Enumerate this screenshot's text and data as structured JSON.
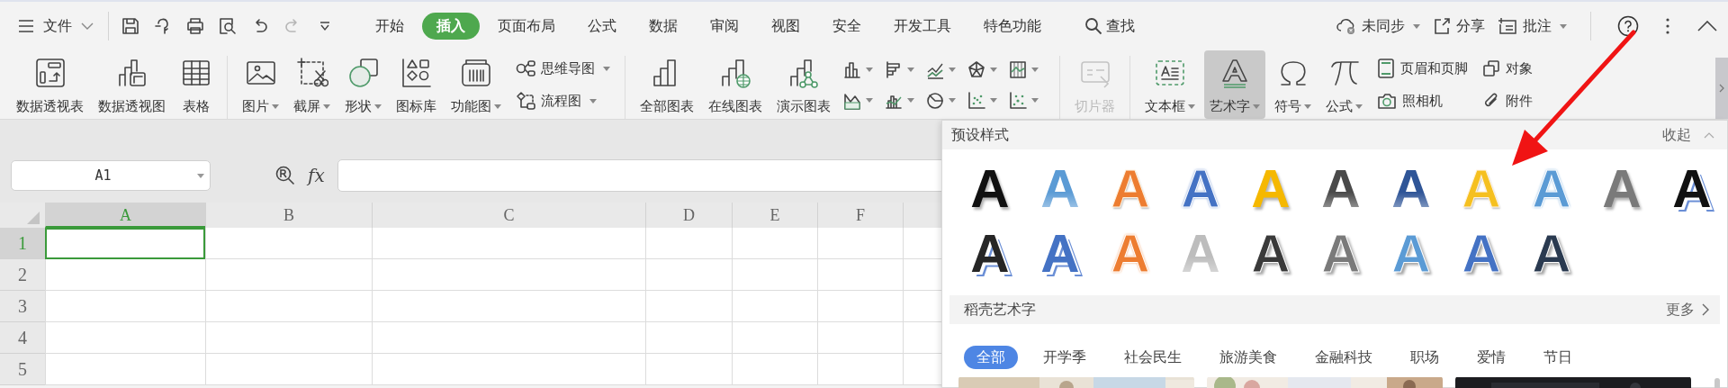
{
  "menu": {
    "label": "文件"
  },
  "quick_access": [
    {
      "disabled": false
    },
    {
      "disabled": false
    },
    {
      "disabled": false
    },
    {
      "disabled": false
    },
    {
      "disabled": false
    },
    {
      "disabled": true
    }
  ],
  "tabs": [
    {
      "label": "开始",
      "selected": false
    },
    {
      "label": "插入",
      "selected": true
    },
    {
      "label": "页面布局",
      "selected": false
    },
    {
      "label": "公式",
      "selected": false
    },
    {
      "label": "数据",
      "selected": false
    },
    {
      "label": "审阅",
      "selected": false
    },
    {
      "label": "视图",
      "selected": false
    },
    {
      "label": "安全",
      "selected": false
    },
    {
      "label": "开发工具",
      "selected": false
    },
    {
      "label": "特色功能",
      "selected": false
    }
  ],
  "search": {
    "label": "查找"
  },
  "actions": [
    {
      "label": "未同步",
      "has_menu": true
    },
    {
      "label": "分享",
      "has_menu": false
    },
    {
      "label": "批注",
      "has_menu": true
    }
  ],
  "ribbon": {
    "groups": [
      {
        "items": [
          {
            "kind": "large",
            "label": "数据透视表",
            "has_menu": false,
            "pressed": false,
            "disabled": false
          },
          {
            "kind": "large",
            "label": "数据透视图",
            "has_menu": false,
            "pressed": false,
            "disabled": false
          },
          {
            "kind": "large",
            "label": "表格",
            "has_menu": false,
            "pressed": false,
            "disabled": false
          }
        ]
      },
      {
        "items": [
          {
            "kind": "large",
            "label": "图片",
            "has_menu": true,
            "pressed": false,
            "disabled": false
          },
          {
            "kind": "large",
            "label": "截屏",
            "has_menu": true,
            "pressed": false,
            "disabled": false
          },
          {
            "kind": "large",
            "label": "形状",
            "has_menu": true,
            "pressed": false,
            "disabled": false
          },
          {
            "kind": "large",
            "label": "图标库",
            "has_menu": false,
            "pressed": false,
            "disabled": false
          },
          {
            "kind": "large",
            "label": "功能图",
            "has_menu": true,
            "pressed": false,
            "disabled": false
          },
          {
            "kind": "stack",
            "items": [
              {
                "label": "思维导图",
                "has_menu": true
              },
              {
                "label": "流程图",
                "has_menu": true
              }
            ]
          }
        ]
      },
      {
        "items": [
          {
            "kind": "large",
            "label": "全部图表",
            "has_menu": false,
            "pressed": false,
            "disabled": false
          },
          {
            "kind": "large",
            "label": "在线图表",
            "has_menu": false,
            "pressed": false,
            "disabled": false
          },
          {
            "kind": "large",
            "label": "演示图表",
            "has_menu": false,
            "pressed": false,
            "disabled": false
          },
          {
            "kind": "charts"
          }
        ]
      },
      {
        "items": [
          {
            "kind": "large",
            "label": "切片器",
            "has_menu": false,
            "pressed": false,
            "disabled": true
          }
        ]
      },
      {
        "items": [
          {
            "kind": "large",
            "label": "文本框",
            "has_menu": true,
            "pressed": false,
            "disabled": false
          },
          {
            "kind": "large",
            "label": "艺术字",
            "has_menu": true,
            "pressed": true,
            "disabled": false
          },
          {
            "kind": "large",
            "label": "符号",
            "has_menu": true,
            "pressed": false,
            "disabled": false
          },
          {
            "kind": "large",
            "label": "公式",
            "has_menu": true,
            "pressed": false,
            "disabled": false
          },
          {
            "kind": "stack",
            "items": [
              {
                "label": "页眉和页脚",
                "has_menu": false
              },
              {
                "label": "照相机",
                "has_menu": false
              }
            ]
          },
          {
            "kind": "stack",
            "items": [
              {
                "label": "对象",
                "has_menu": false
              },
              {
                "label": "附件",
                "has_menu": false
              }
            ]
          }
        ]
      }
    ]
  },
  "sheet": {
    "name_box": {
      "value": "A1"
    },
    "formula_label": "fx",
    "columns": [
      {
        "label": "A",
        "selected": true
      },
      {
        "label": "B",
        "selected": false
      },
      {
        "label": "C",
        "selected": false
      },
      {
        "label": "D",
        "selected": false
      },
      {
        "label": "E",
        "selected": false
      },
      {
        "label": "F",
        "selected": false
      }
    ],
    "rows": [
      {
        "label": "1",
        "selected": true
      },
      {
        "label": "2",
        "selected": false
      },
      {
        "label": "3",
        "selected": false
      },
      {
        "label": "4",
        "selected": false
      },
      {
        "label": "5",
        "selected": false
      }
    ]
  },
  "wordart_panel": {
    "title": "预设样式",
    "collapse": "收起",
    "presets": [
      {
        "text": "A",
        "kind": "solid",
        "color": "#111111"
      },
      {
        "text": "A",
        "kind": "gradient",
        "color": "#5b9bd5"
      },
      {
        "text": "A",
        "kind": "filled-outline",
        "color": "#ed7d31"
      },
      {
        "text": "A",
        "kind": "outline",
        "color": "#4472c4"
      },
      {
        "text": "A",
        "kind": "solid",
        "color": "#f5b800"
      },
      {
        "text": "A",
        "kind": "gradient",
        "color": "#4a4a4a"
      },
      {
        "text": "A",
        "kind": "gradient",
        "color": "#2f5597"
      },
      {
        "text": "A",
        "kind": "filled-outline",
        "color": "#f5c020"
      },
      {
        "text": "A",
        "kind": "outline",
        "color": "#5b9bd5"
      },
      {
        "text": "A",
        "kind": "solid",
        "color": "#7a7a7a"
      },
      {
        "text": "A",
        "kind": "shadow",
        "color": "#111111"
      },
      {
        "text": "A",
        "kind": "shadow",
        "color": "#262626"
      },
      {
        "text": "A",
        "kind": "shadow",
        "color": "#4472c4"
      },
      {
        "text": "A",
        "kind": "outline",
        "color": "#ed7d31"
      },
      {
        "text": "A",
        "kind": "gradient",
        "color": "#bdbdbd"
      },
      {
        "text": "A",
        "kind": "pattern",
        "color": "#3a3a3a"
      },
      {
        "text": "A",
        "kind": "pattern",
        "color": "#7a7a7a"
      },
      {
        "text": "A",
        "kind": "pattern",
        "color": "#5b9bd5"
      },
      {
        "text": "A",
        "kind": "pattern",
        "color": "#4472c4"
      },
      {
        "text": "A",
        "kind": "pattern",
        "color": "#2a3a50"
      }
    ],
    "docer_title": "稻壳艺术字",
    "more": "更多",
    "categories": [
      {
        "label": "全部",
        "selected": true
      },
      {
        "label": "开学季",
        "selected": false
      },
      {
        "label": "社会民生",
        "selected": false
      },
      {
        "label": "旅游美食",
        "selected": false
      },
      {
        "label": "金融科技",
        "selected": false
      },
      {
        "label": "职场",
        "selected": false
      },
      {
        "label": "爱情",
        "selected": false
      },
      {
        "label": "节日",
        "selected": false
      }
    ]
  }
}
